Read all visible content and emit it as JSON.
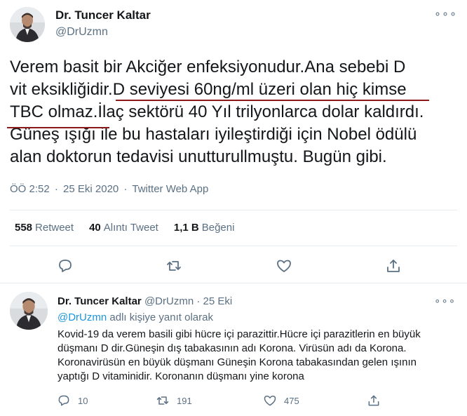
{
  "main_tweet": {
    "author_name": "Dr. Tuncer Kaltar",
    "author_handle": "@DrUzmn",
    "more_label": "∘∘∘",
    "text_lines": [
      "Verem basit bir Akciğer enfeksiyonudur.Ana sebebi D",
      "vit eksikliğidir.D seviyesi 60ng/ml üzeri olan hiç kimse",
      "TBC olmaz.İlaç sektörü 40 Yıl trilyonlarca dolar kaldırdı.",
      "Güneş ışığı ile bu hastaları iyileştirdiği için Nobel ödülü",
      "alan doktorun tedavisi unutturullmuştu. Bugün gibi."
    ],
    "time": "ÖÖ 2:52",
    "date": "25 Eki 2020",
    "source": "Twitter Web App",
    "separator": "·",
    "stats": {
      "retweet_count": "558",
      "retweet_label": "Retweet",
      "quote_count": "40",
      "quote_label": "Alıntı Tweet",
      "like_count": "1,1 B",
      "like_label": "Beğeni"
    },
    "icons": [
      "reply-icon",
      "retweet-icon",
      "like-icon",
      "share-icon"
    ]
  },
  "reply_tweet": {
    "author_name": "Dr. Tuncer Kaltar",
    "author_handle": "@DrUzmn",
    "separator": "·",
    "date": "25 Eki",
    "more_label": "∘∘∘",
    "replying_to_mention": "@DrUzmn",
    "replying_to_suffix": "adlı kişiye yanıt olarak",
    "text": "Kovid-19 da verem basili gibi hücre içi parazittir.Hücre içi parazitlerin en büyük düşmanı D dir.Güneşin dış tabakasının adı Korona. Virüsün adı da Korona. Koronavirüsün en büyük düşmanı Güneşin Korona tabakasından gelen ışının yaptığı D vitaminidir. Koronanın düşmanı yine korona",
    "reply_count": "10",
    "retweet_count": "191",
    "like_count": "475",
    "icons": [
      "reply-icon",
      "retweet-icon",
      "like-icon",
      "share-icon"
    ]
  },
  "colors": {
    "link": "#1b95e0",
    "secondary_text": "#5b7083",
    "primary_text": "#14171a",
    "underline": "#8b1a1a",
    "divider": "#e6ecf0"
  }
}
